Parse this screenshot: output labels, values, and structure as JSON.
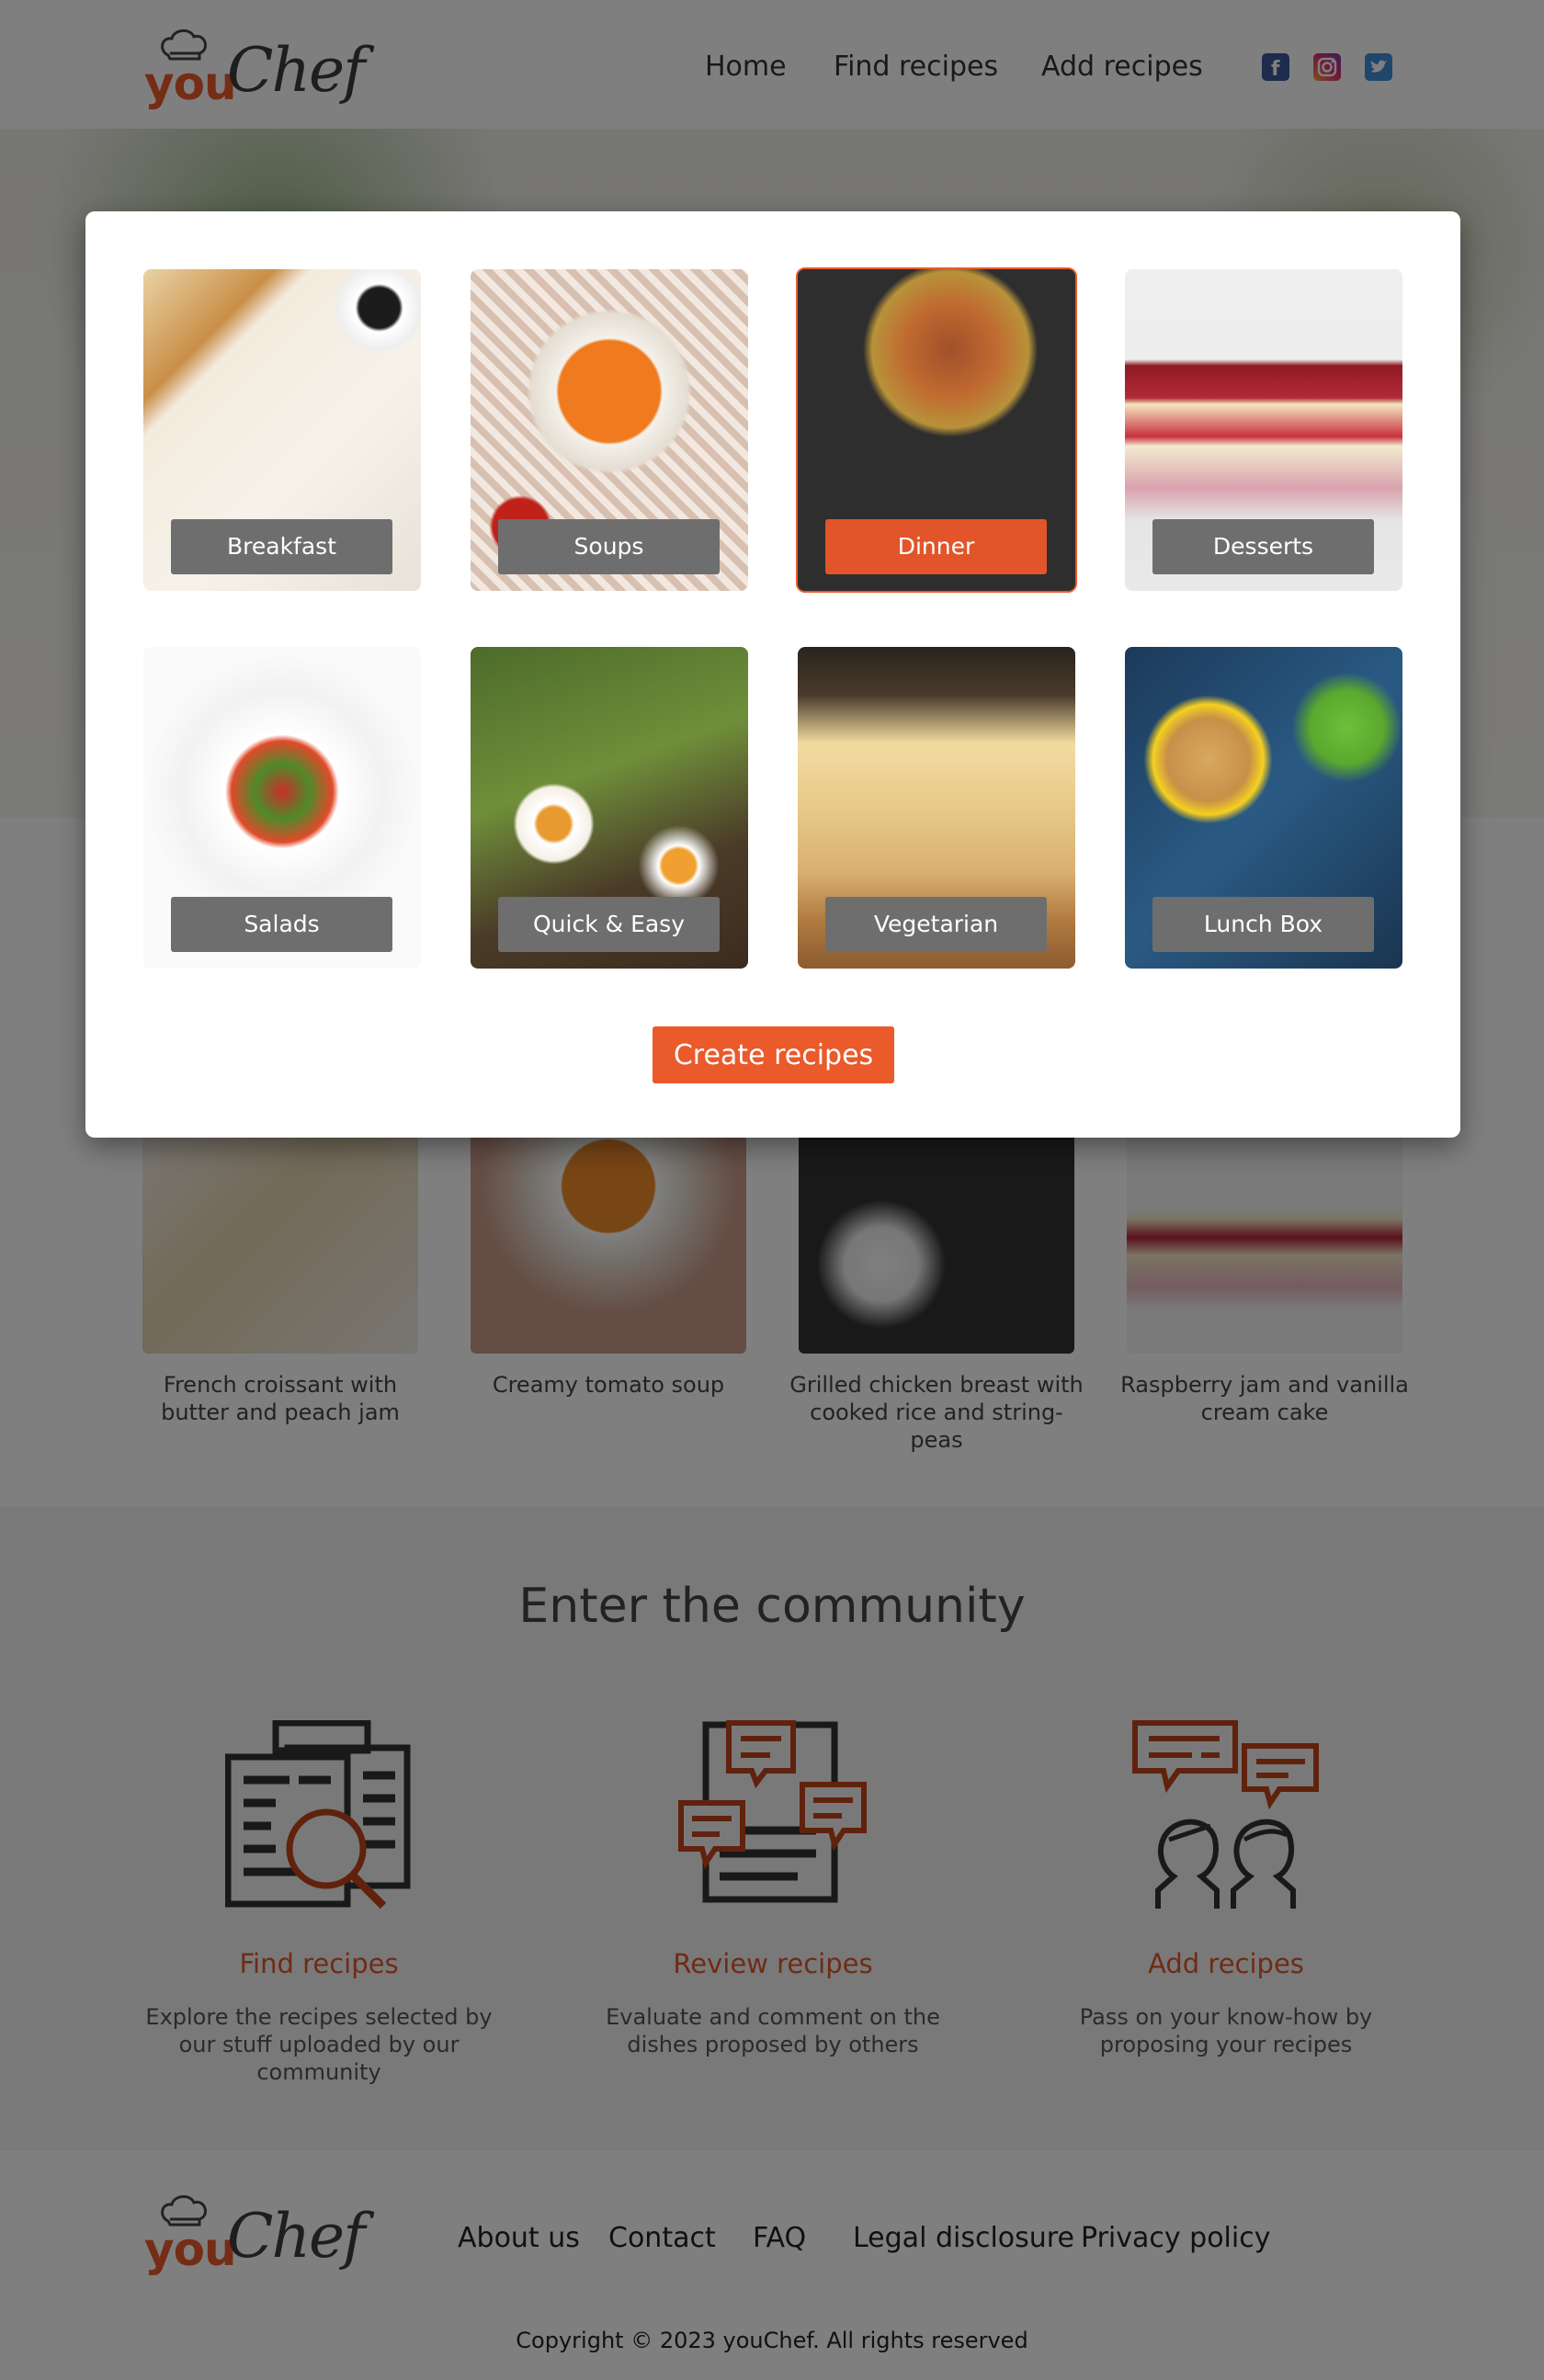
{
  "brand": {
    "logo_you": "you",
    "logo_chef": "Chef"
  },
  "nav": {
    "home": "Home",
    "find": "Find recipes",
    "add": "Add recipes"
  },
  "social": [
    "facebook-icon",
    "instagram-icon",
    "twitter-icon"
  ],
  "modal": {
    "categories": [
      {
        "label": "Breakfast",
        "selected": false
      },
      {
        "label": "Soups",
        "selected": false
      },
      {
        "label": "Dinner",
        "selected": true
      },
      {
        "label": "Desserts",
        "selected": false
      },
      {
        "label": "Salads",
        "selected": false
      },
      {
        "label": "Quick & Easy",
        "selected": false
      },
      {
        "label": "Vegetarian",
        "selected": false
      },
      {
        "label": "Lunch Box",
        "selected": false
      }
    ],
    "create_label": "Create recipes"
  },
  "recipes": [
    {
      "caption": "French croissant with butter and peach jam"
    },
    {
      "caption": "Creamy tomato soup"
    },
    {
      "caption": "Grilled chicken breast with cooked rice and string-peas"
    },
    {
      "caption": "Raspberry jam and vanilla cream cake"
    }
  ],
  "community": {
    "title": "Enter the community",
    "items": [
      {
        "heading": "Find recipes",
        "text": "Explore the recipes selected by our stuff uploaded by our community"
      },
      {
        "heading": "Review recipes",
        "text": "Evaluate and comment on the dishes proposed by others"
      },
      {
        "heading": "Add recipes",
        "text": "Pass on your know-how by proposing your recipes"
      }
    ]
  },
  "footer": {
    "links": [
      "About us",
      "Contact",
      "FAQ",
      "Legal disclosure",
      "Privacy policy"
    ],
    "copyright": "Copyright © 2023 youChef. All rights reserved"
  },
  "colors": {
    "accent": "#ea5a2a",
    "overlay": "rgba(0,0,0,0.5)"
  }
}
